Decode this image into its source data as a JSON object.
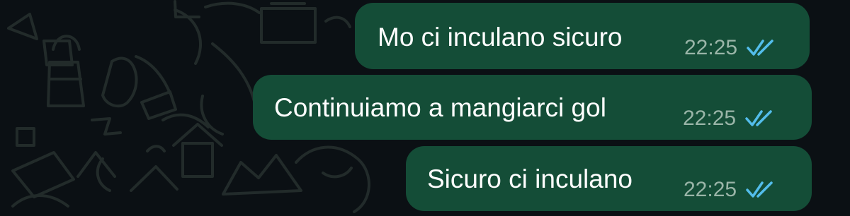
{
  "chat": {
    "background_color": "#0b1014",
    "bubble_color": "#144d37",
    "tick_color": "#53bdeb",
    "messages": [
      {
        "text": "Mo ci inculano sicuro",
        "time": "22:25",
        "status_icon": "double-check-read-icon"
      },
      {
        "text": "Continuiamo a mangiarci gol",
        "time": "22:25",
        "status_icon": "double-check-read-icon"
      },
      {
        "text": "Sicuro ci inculano",
        "time": "22:25",
        "status_icon": "double-check-read-icon"
      }
    ]
  }
}
